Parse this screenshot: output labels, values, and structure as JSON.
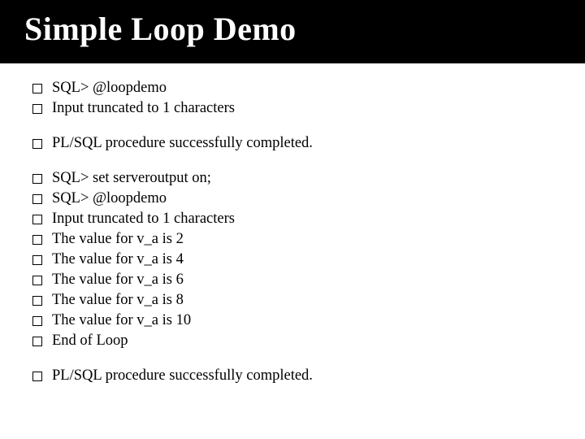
{
  "title": "Simple  Loop  Demo",
  "groups": [
    [
      "SQL> @loopdemo",
      "Input truncated to 1 characters"
    ],
    [
      "PL/SQL procedure successfully completed."
    ],
    [
      "SQL> set serveroutput on;",
      "SQL>  @loopdemo",
      "Input truncated to 1 characters",
      "The value for v_a is 2",
      "The value for v_a is 4",
      "The value for v_a is 6",
      "The value for v_a is 8",
      "The value for v_a is 10",
      "End of Loop"
    ],
    [
      "PL/SQL procedure successfully completed."
    ]
  ]
}
